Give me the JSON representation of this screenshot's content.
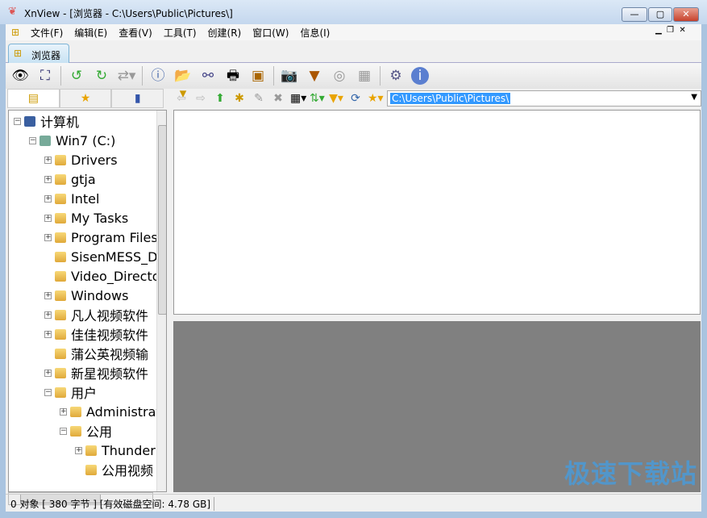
{
  "window": {
    "title": "XnView - [浏览器 - C:\\Users\\Public\\Pictures\\]",
    "min": "—",
    "max": "▢",
    "close": "✕"
  },
  "menu": [
    "文件(F)",
    "编辑(E)",
    "查看(V)",
    "工具(T)",
    "创建(R)",
    "窗口(W)",
    "信息(I)"
  ],
  "tab": {
    "label": "浏览器"
  },
  "address": {
    "value": "C:\\Users\\Public\\Pictures\\"
  },
  "tree": [
    {
      "label": "计算机",
      "level": 0,
      "exp": "−"
    },
    {
      "label": "Win7 (C:)",
      "level": 1,
      "exp": "−"
    },
    {
      "label": "Drivers",
      "level": 2,
      "exp": "+"
    },
    {
      "label": "gtja",
      "level": 2,
      "exp": "+"
    },
    {
      "label": "Intel",
      "level": 2,
      "exp": "+"
    },
    {
      "label": "My Tasks",
      "level": 2,
      "exp": "+"
    },
    {
      "label": "Program Files",
      "level": 2,
      "exp": "+"
    },
    {
      "label": "SisenMESS_Data",
      "level": 2,
      "exp": ""
    },
    {
      "label": "Video_Director",
      "level": 2,
      "exp": ""
    },
    {
      "label": "Windows",
      "level": 2,
      "exp": "+"
    },
    {
      "label": "凡人视频软件",
      "level": 2,
      "exp": "+"
    },
    {
      "label": "佳佳视频软件",
      "level": 2,
      "exp": "+"
    },
    {
      "label": "蒲公英视频输",
      "level": 2,
      "exp": ""
    },
    {
      "label": "新星视频软件",
      "level": 2,
      "exp": "+"
    },
    {
      "label": "用户",
      "level": 2,
      "exp": "−"
    },
    {
      "label": "Administrator",
      "level": 3,
      "exp": "+"
    },
    {
      "label": "公用",
      "level": 3,
      "exp": "−"
    },
    {
      "label": "Thunder",
      "level": 4,
      "exp": "+"
    },
    {
      "label": "公用视频",
      "level": 4,
      "exp": ""
    }
  ],
  "status": {
    "text": "0 对象 [ 380 字节 ] [有效磁盘空间: 4.78 GB]"
  },
  "watermark": "极速下载站"
}
